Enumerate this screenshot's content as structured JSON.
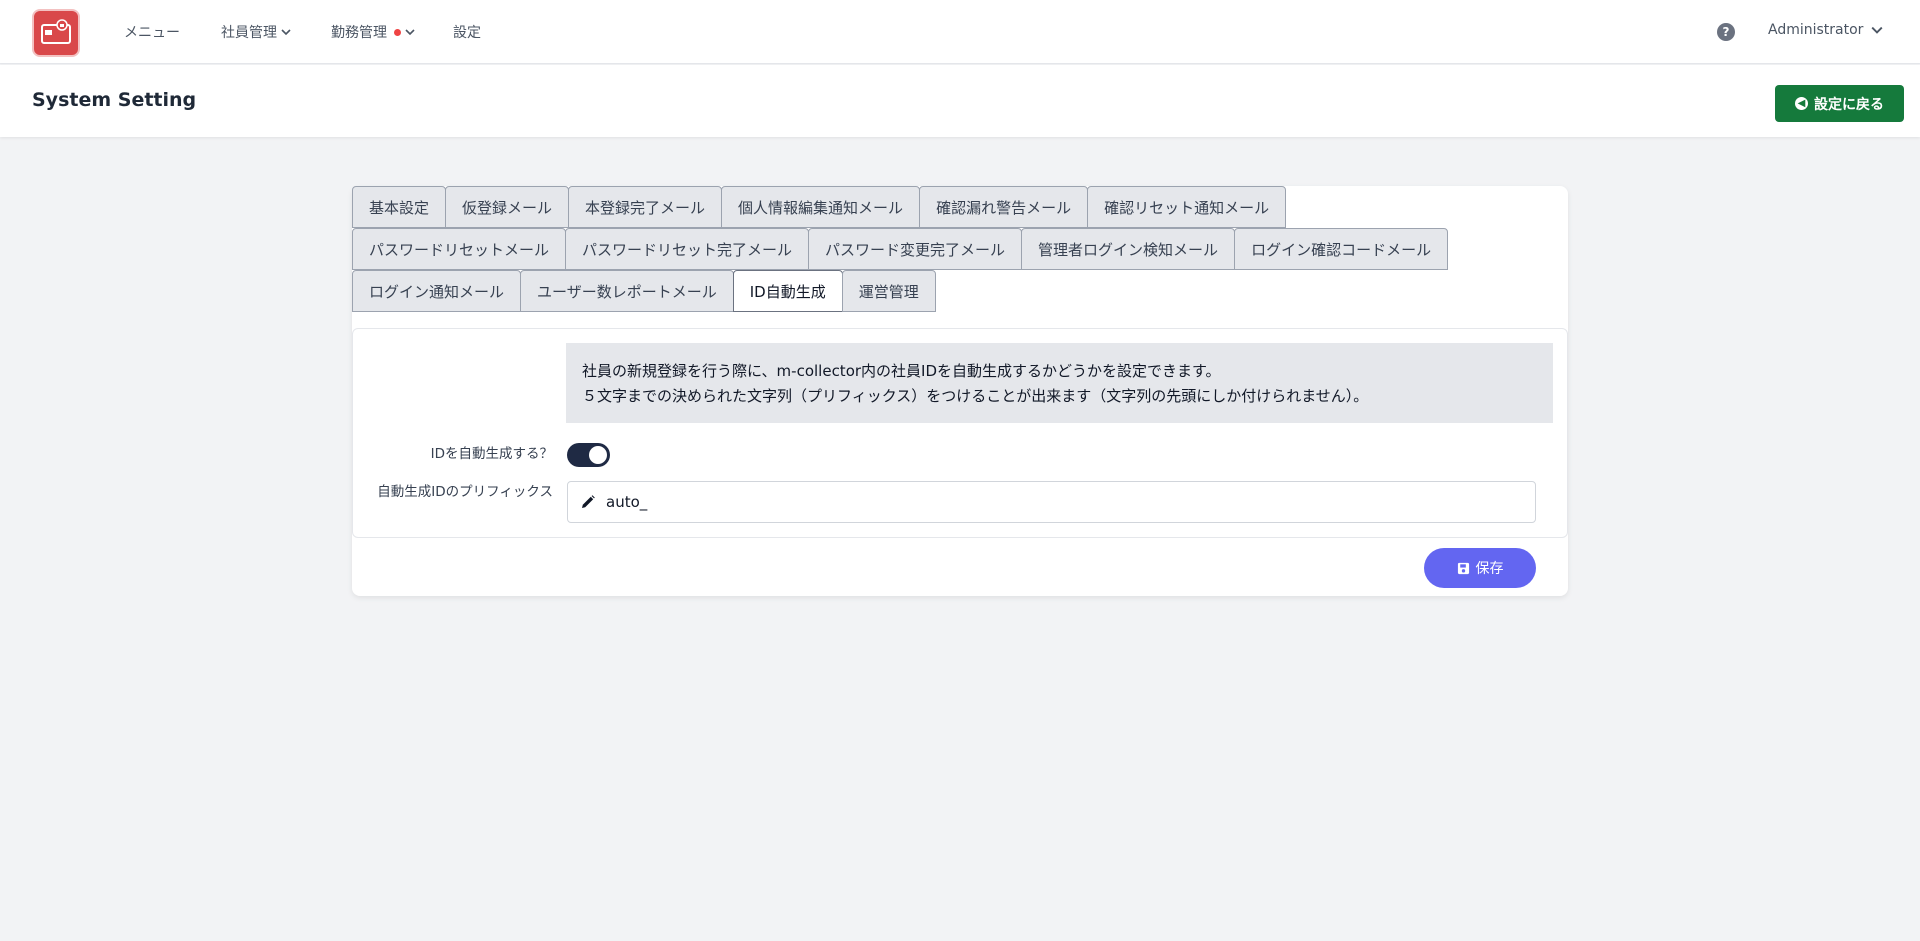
{
  "nav": {
    "menu": "メニュー",
    "employee_mgmt": "社員管理",
    "attendance_mgmt": "勤務管理",
    "settings": "設定",
    "user": "Administrator"
  },
  "header": {
    "title": "System Setting",
    "back_button": "設定に戻る"
  },
  "tabs": {
    "row1": [
      "基本設定",
      "仮登録メール",
      "本登録完了メール",
      "個人情報編集通知メール",
      "確認漏れ警告メール",
      "確認リセット通知メール"
    ],
    "row2": [
      "パスワードリセットメール",
      "パスワードリセット完了メール",
      "パスワード変更完了メール",
      "管理者ログイン検知メール",
      "ログイン確認コードメール"
    ],
    "row3": [
      "ログイン通知メール",
      "ユーザー数レポートメール",
      "ID自動生成",
      "運営管理"
    ],
    "active": "ID自動生成"
  },
  "panel": {
    "info_line1": "社員の新規登録を行う際に、m-collector内の社員IDを自動生成するかどうかを設定できます。",
    "info_line2": "５文字までの決められた文字列（プリフィックス）をつけることが出来ます（文字列の先頭にしか付けられません）。",
    "auto_id_label": "IDを自動生成する？",
    "auto_id_enabled": true,
    "prefix_label": "自動生成IDのプリフィックス",
    "prefix_value": "auto_",
    "save_button": "保存"
  },
  "colors": {
    "back_button": "#157a3c",
    "save_button": "#6366f1",
    "toggle_on": "#1f2a44",
    "logo": "#d9484a",
    "notification_dot": "#ef4444"
  }
}
